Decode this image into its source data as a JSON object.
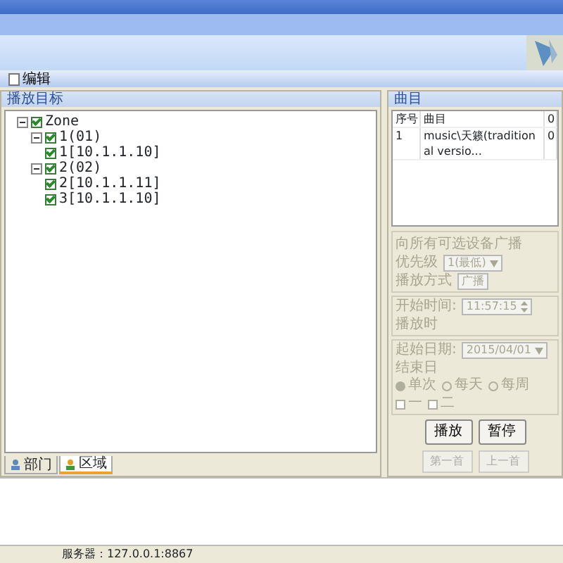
{
  "toolbar": {
    "button": "编辑"
  },
  "tree_panel": {
    "title": "播放目标",
    "tree": [
      {
        "label": "Zone",
        "checked": true,
        "expanded": true,
        "children": [
          {
            "label": "1(01)",
            "checked": true,
            "expanded": true,
            "children": [
              {
                "label": "1[10.1.1.10]",
                "checked": true
              }
            ]
          },
          {
            "label": "2(02)",
            "checked": true,
            "expanded": true,
            "children": [
              {
                "label": "2[10.1.1.11]",
                "checked": true
              },
              {
                "label": "3[10.1.1.10]",
                "checked": true
              }
            ]
          }
        ]
      }
    ],
    "tabs": [
      {
        "label": "部门",
        "selected": false
      },
      {
        "label": "区域",
        "selected": true
      }
    ]
  },
  "playlist": {
    "title": "曲目",
    "columns": [
      "序号",
      "曲目",
      "0"
    ],
    "rows": [
      [
        "1",
        "music\\天籁(traditional versio...",
        "0"
      ]
    ]
  },
  "settings": {
    "broadcast_all": "向所有可选设备广播",
    "priority_label": "优先级",
    "priority": "1(最低)",
    "mode_label": "播放方式",
    "mode": "广播",
    "start_time_label": "开始时间:",
    "start_time": "11:57:15",
    "play_time_label": "播放时",
    "start_date_label": "起始日期:",
    "start_date": "2015/04/01",
    "end_date_label": "结束日",
    "repeat": [
      {
        "label": "单次",
        "selected": true
      },
      {
        "label": "每天",
        "selected": false
      },
      {
        "label": "每周",
        "selected": false
      }
    ],
    "weekdays": [
      {
        "label": "一",
        "checked": false
      },
      {
        "label": "二",
        "checked": false
      }
    ]
  },
  "buttons": [
    {
      "label": "播放",
      "enabled": true
    },
    {
      "label": "暂停",
      "enabled": true
    }
  ],
  "nav_buttons": [
    {
      "label": "第一首"
    },
    {
      "label": "上一首"
    }
  ],
  "status_bar": {
    "server": "服务器：127.0.0.1:8867"
  }
}
